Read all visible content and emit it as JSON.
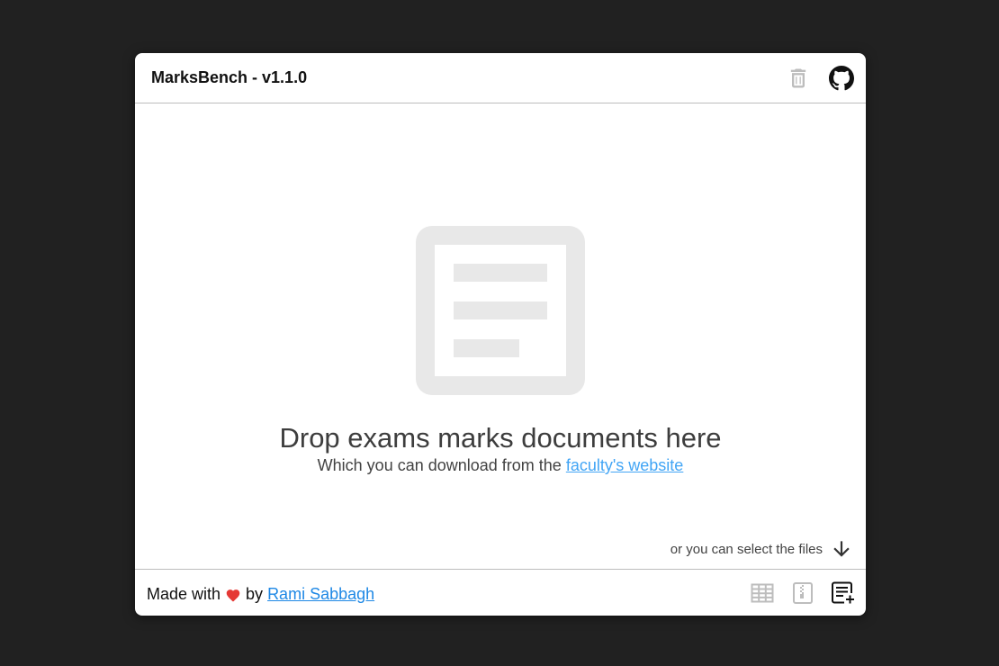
{
  "app": {
    "title": "MarksBench - v1.1.0"
  },
  "header": {
    "icons": [
      "trash-icon",
      "github-icon"
    ]
  },
  "dropzone": {
    "icon": "document-icon",
    "title": "Drop exams marks documents here",
    "subtitle_prefix": "Which you can download from the ",
    "subtitle_link": "faculty's website",
    "select_hint": "or you can select the files",
    "select_icon": "arrow-down-icon"
  },
  "footer": {
    "made_with": "Made with",
    "by": "by",
    "author": "Rami Sabbagh",
    "icons": [
      "table-icon",
      "zip-icon",
      "add-document-icon"
    ]
  },
  "colors": {
    "background": "#212121",
    "card": "#ffffff",
    "link": "#42a5f5",
    "author_link": "#1e88e5",
    "heart": "#e53935",
    "disabled_icon": "#bdbdbd"
  }
}
